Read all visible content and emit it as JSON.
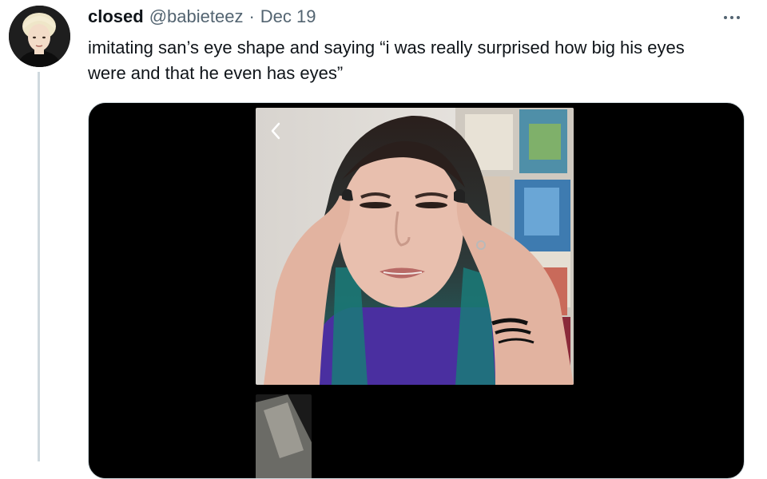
{
  "tweet": {
    "display_name": "closed",
    "handle": "@babieteez",
    "separator": "·",
    "date": "Dec 19",
    "text": "imitating san’s eye shape and saying “i was really surprised how big his eyes were and that he even has eyes”",
    "more_icon": "more-horizontal-icon"
  },
  "media": {
    "type": "video",
    "back_icon": "chevron-left-icon"
  },
  "colors": {
    "secondary_text": "#536471",
    "thread_line": "#cfd9de",
    "media_background": "#000000"
  }
}
